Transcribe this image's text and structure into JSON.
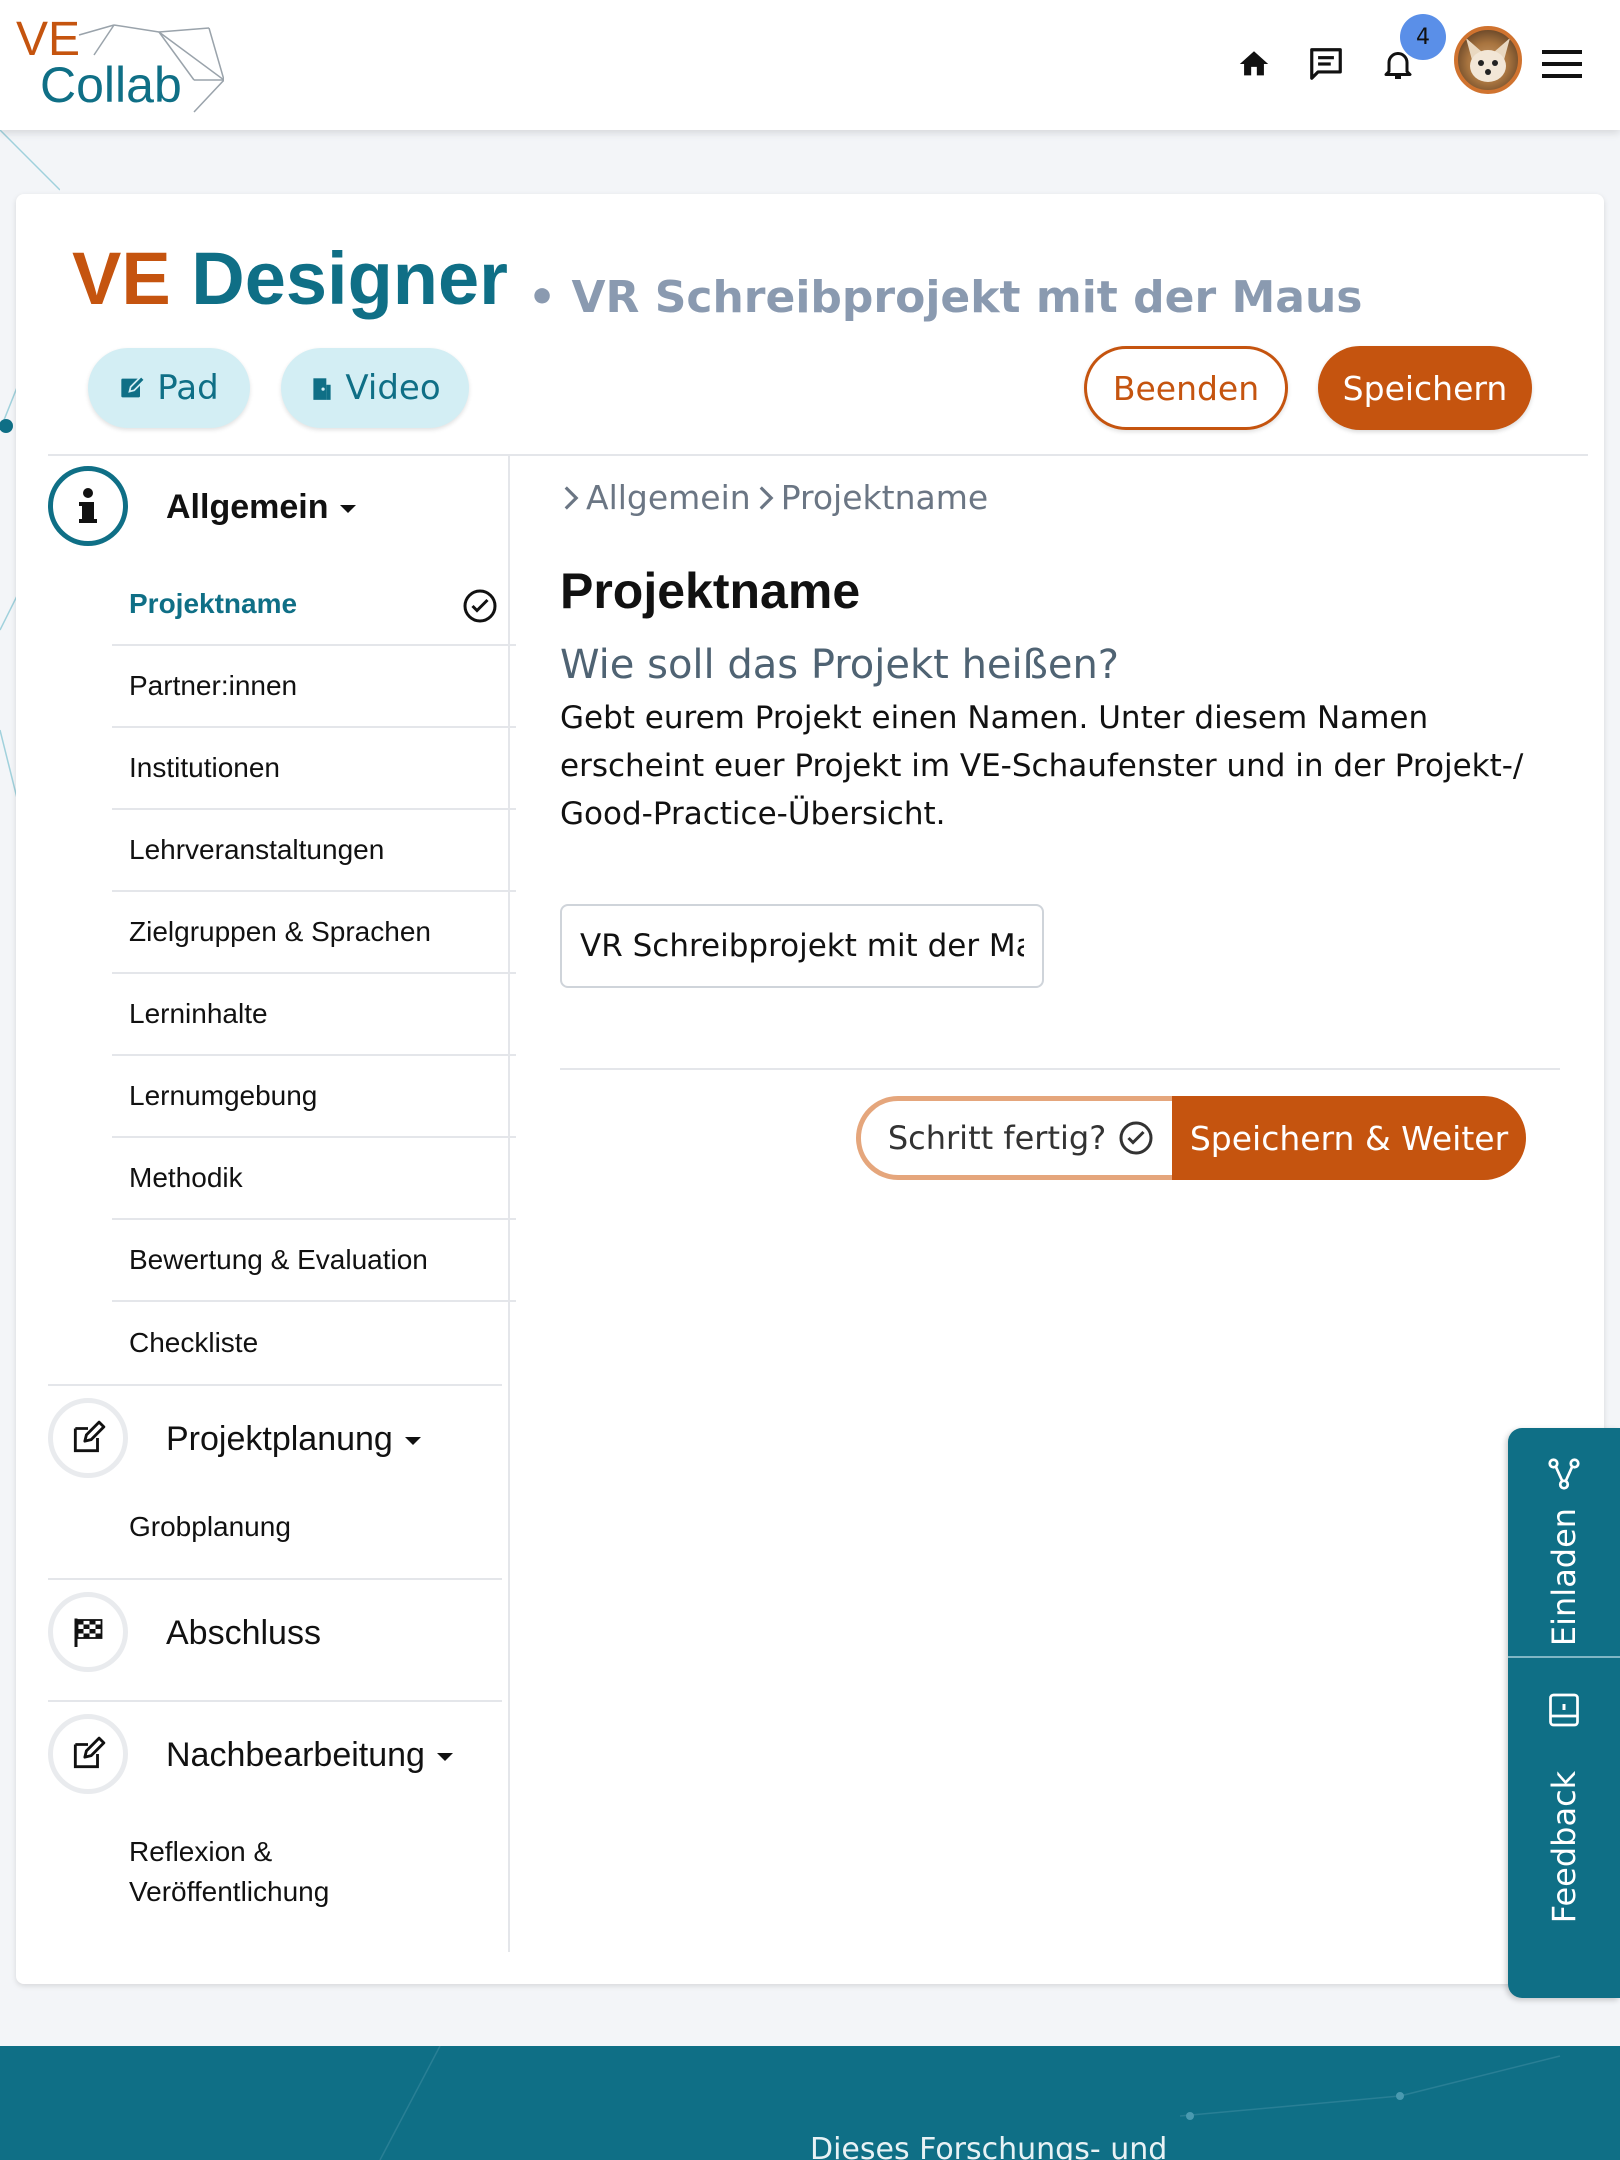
{
  "header": {
    "logo": {
      "ve": "VE",
      "collab": "Collab"
    },
    "icons": [
      "home-icon",
      "chat-icon",
      "bell-icon",
      "menu-icon"
    ],
    "notification_count": "4"
  },
  "designer": {
    "title_part1": "VE",
    "title_part2": "Designer",
    "project_subtitle": "• VR Schreibprojekt mit der Maus",
    "pad_label": "Pad",
    "video_label": "Video",
    "end_label": "Beenden",
    "save_label": "Speichern"
  },
  "sidebar": {
    "sections": [
      {
        "label": "Allgemein",
        "icon": "info-icon",
        "items": [
          {
            "label": "Projektname",
            "active": true,
            "done": true
          },
          {
            "label": "Partner:innen"
          },
          {
            "label": "Institutionen"
          },
          {
            "label": "Lehrveranstaltungen"
          },
          {
            "label": "Zielgruppen & Sprachen"
          },
          {
            "label": "Lerninhalte"
          },
          {
            "label": "Lernumgebung"
          },
          {
            "label": "Methodik"
          },
          {
            "label": "Bewertung & Evaluation"
          },
          {
            "label": "Checkliste"
          }
        ]
      },
      {
        "label": "Projektplanung",
        "icon": "edit-icon",
        "items": [
          {
            "label": "Grobplanung"
          }
        ]
      },
      {
        "label": "Abschluss",
        "icon": "checkered-flag-icon",
        "items": []
      },
      {
        "label": "Nachbearbeitung",
        "icon": "edit-icon",
        "items": [
          {
            "label": "Reflexion & Veröffentlichung",
            "line1": "Reflexion &",
            "line2": "Veröffentlichung"
          }
        ]
      }
    ]
  },
  "content": {
    "breadcrumb": [
      "Allgemein",
      "Projektname"
    ],
    "title": "Projektname",
    "question": "Wie soll das Projekt heißen?",
    "description_lines": [
      "Gebt eurem Projekt einen Namen. Unter diesem Namen",
      "erscheint euer Projekt im VE-Schaufenster und in der Projekt-/",
      "Good-Practice-Übersicht."
    ],
    "input_value": "VR Schreibprojekt mit der Maus",
    "step_done_label": "Schritt fertig?",
    "save_next_label": "Speichern & Weiter"
  },
  "side_tabs": {
    "invite": "Einladen",
    "feedback": "Feedback"
  },
  "footer": {
    "text": "Dieses Forschungs- und"
  },
  "colors": {
    "brand_orange": "#c5540f",
    "brand_teal": "#0f6f86",
    "badge_blue": "#5a8fe8"
  }
}
